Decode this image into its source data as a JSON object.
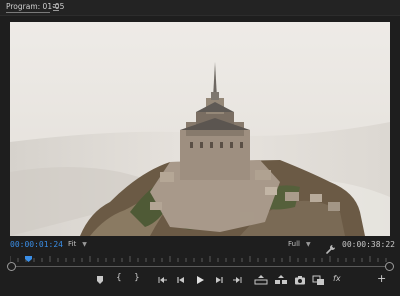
{
  "panel": {
    "title": "Program: 01-05"
  },
  "viewer": {
    "image_description_icon": "landscape-photo"
  },
  "transport": {
    "current_timecode": "00:00:01:24",
    "zoom_level": "Fit",
    "playback_resolution": "Full",
    "duration_timecode": "00:00:38:22",
    "playhead_progress": 0.04
  },
  "buttons": {
    "add_marker": "marker-icon",
    "mark_in": "{",
    "mark_out": "}",
    "go_to_in": "go-to-in-icon",
    "step_back": "step-back-icon",
    "play": "play-icon",
    "step_forward": "step-forward-icon",
    "go_to_out": "go-to-out-icon",
    "lift": "lift-icon",
    "extract": "extract-icon",
    "export_frame": "camera-icon",
    "comparison_view": "comparison-view-icon",
    "fx": "fx",
    "add": "+"
  },
  "colors": {
    "accent_timecode": "#3a8ee6",
    "panel_bg": "#1e1e1e",
    "icon": "#c8c8c8"
  }
}
